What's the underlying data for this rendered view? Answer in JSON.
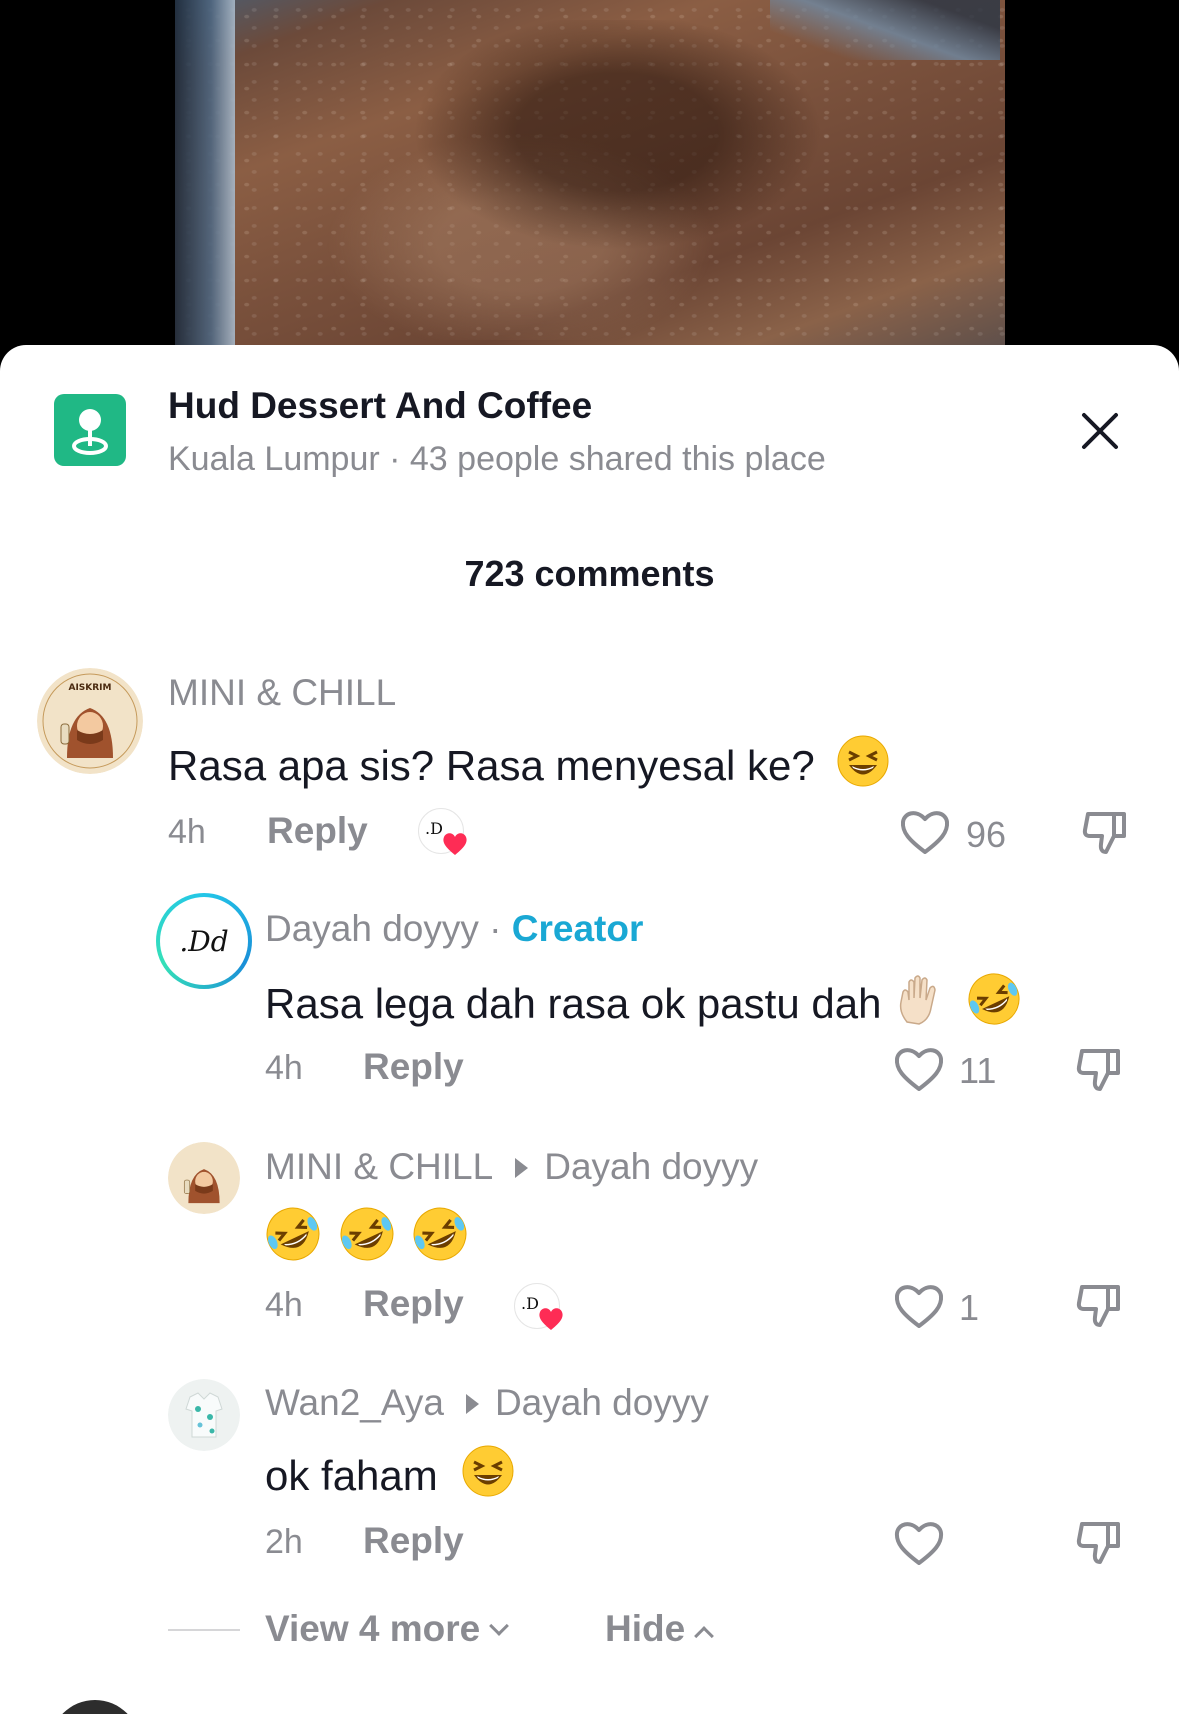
{
  "place": {
    "icon": "location-pin-icon",
    "name": "Hud Dessert And Coffee",
    "subtitle": "Kuala Lumpur · 43 people shared this place"
  },
  "comments_header": {
    "count_label": "723 comments"
  },
  "comments": [
    {
      "username": "MINI & CHILL",
      "text": "Rasa apa sis? Rasa menyesal ke?",
      "emoji": "grinning-squinting-face",
      "time": "4h",
      "reply_label": "Reply",
      "creator_liked": true,
      "likes": "96"
    }
  ],
  "replies": [
    {
      "username": "Dayah doyyy",
      "separator": "·",
      "badge": "Creator",
      "text": "Rasa lega dah rasa ok pastu dah",
      "emojis": [
        "raised-hand",
        "rolling-laughing-face"
      ],
      "time": "4h",
      "reply_label": "Reply",
      "likes": "11"
    },
    {
      "username": "MINI & CHILL",
      "reply_to": "Dayah doyyy",
      "emojis": [
        "rolling-laughing-face",
        "rolling-laughing-face",
        "rolling-laughing-face"
      ],
      "time": "4h",
      "reply_label": "Reply",
      "creator_liked": true,
      "likes": "1"
    },
    {
      "username": "Wan2_Aya",
      "reply_to": "Dayah doyyy",
      "text": "ok faham",
      "emoji": "grinning-squinting-face",
      "time": "2h",
      "reply_label": "Reply",
      "likes": ""
    }
  ],
  "footer": {
    "view_more_label": "View 4 more",
    "hide_label": "Hide"
  },
  "colors": {
    "place_icon_bg": "#20b885",
    "creator_badge": "#1aa8d4",
    "liked_heart": "#fe2c55",
    "muted_text": "#8a8b91",
    "primary_text": "#161823"
  }
}
